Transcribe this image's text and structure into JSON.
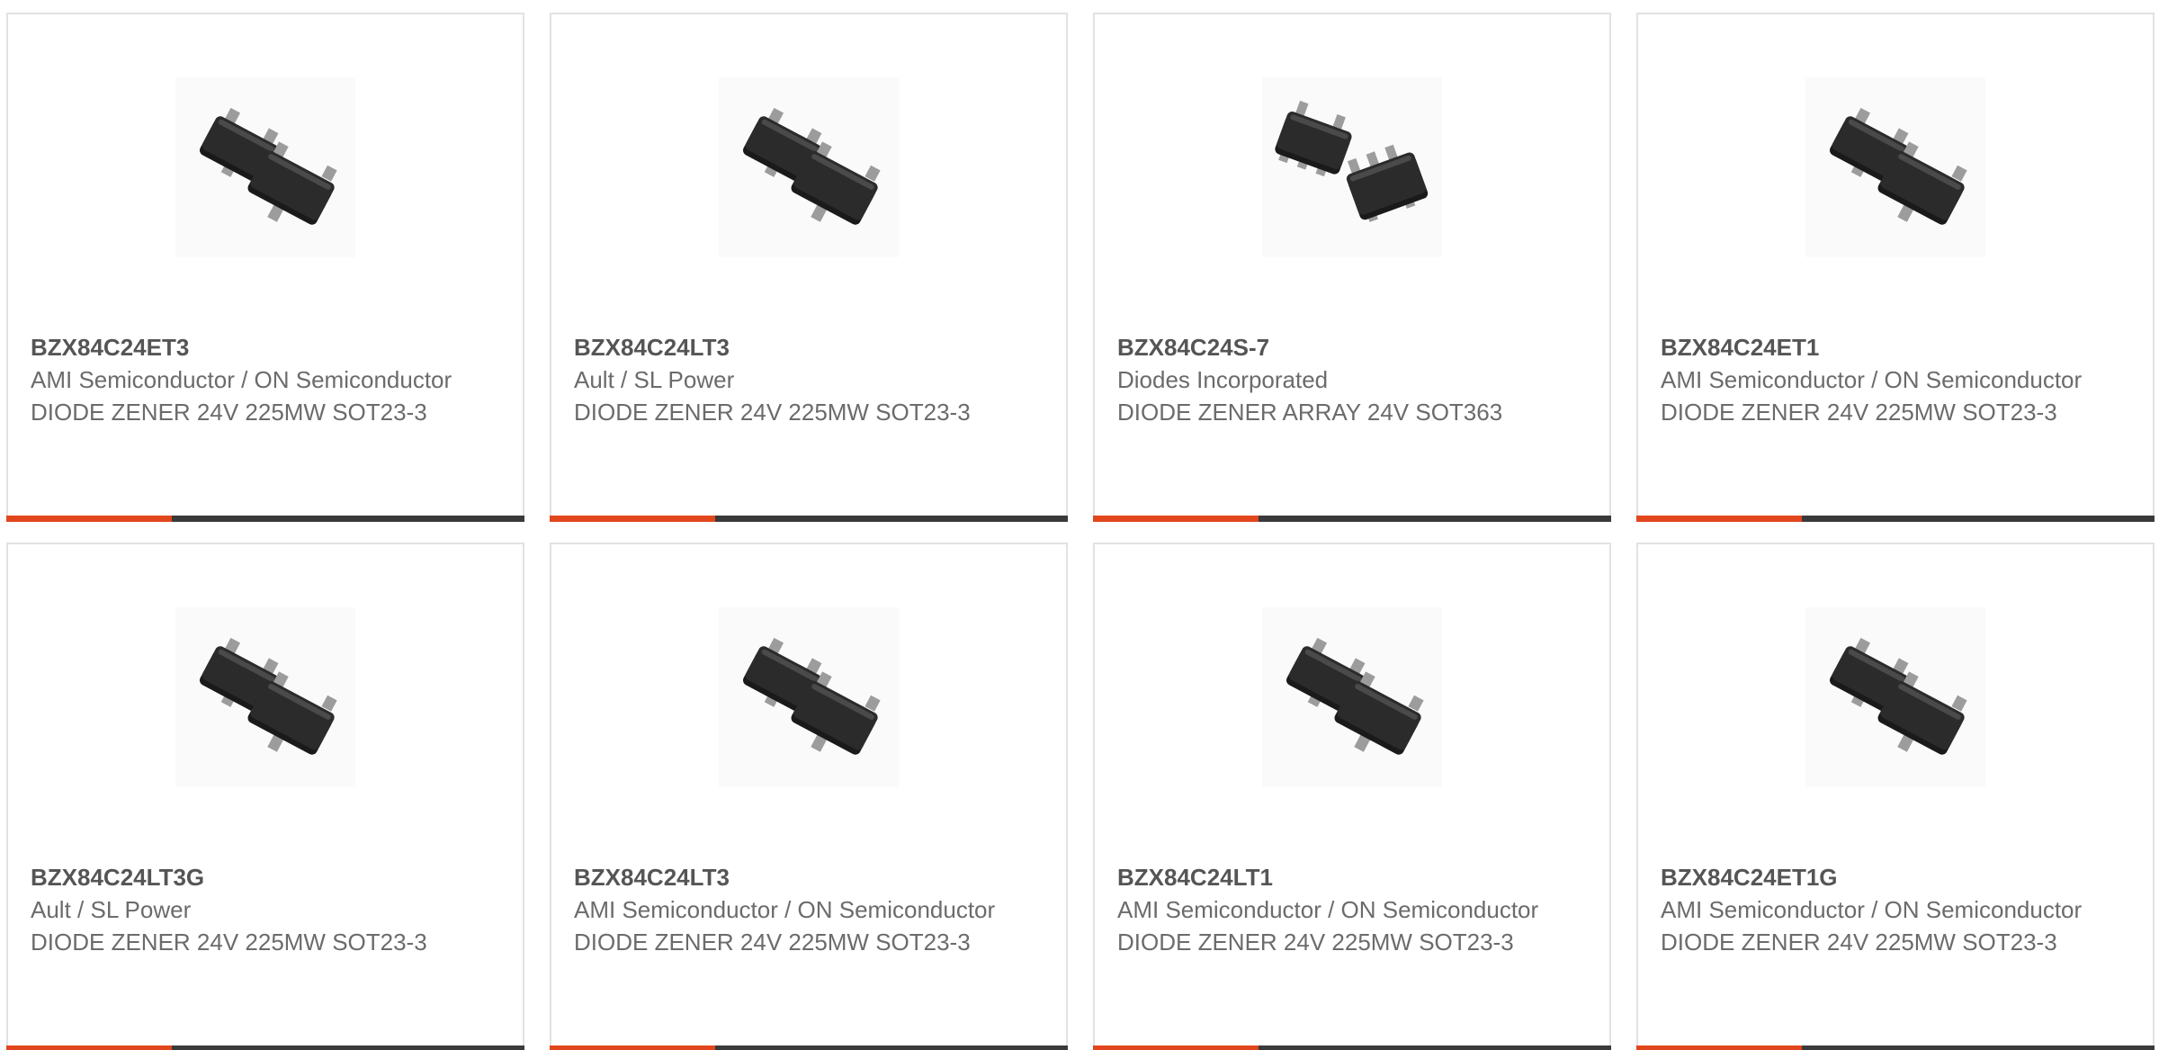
{
  "colors": {
    "accent": "#e2461c",
    "bar_dark": "#3a3a3a",
    "chip_body": "#2b2b2b",
    "chip_lead": "#9c9c9c"
  },
  "products": [
    {
      "part": "BZX84C24ET3",
      "manufacturer": "AMI Semiconductor / ON Semiconductor",
      "description": "DIODE ZENER 24V 225MW SOT23-3",
      "image_icon": "sot23-3-package-icon"
    },
    {
      "part": "BZX84C24LT3",
      "manufacturer": "Ault / SL Power",
      "description": "DIODE ZENER 24V 225MW SOT23-3",
      "image_icon": "sot23-3-package-icon"
    },
    {
      "part": "BZX84C24S-7",
      "manufacturer": "Diodes Incorporated",
      "description": "DIODE ZENER ARRAY 24V SOT363",
      "image_icon": "sot363-package-icon"
    },
    {
      "part": "BZX84C24ET1",
      "manufacturer": "AMI Semiconductor / ON Semiconductor",
      "description": "DIODE ZENER 24V 225MW SOT23-3",
      "image_icon": "sot23-3-package-icon"
    },
    {
      "part": "BZX84C24LT3G",
      "manufacturer": "Ault / SL Power",
      "description": "DIODE ZENER 24V 225MW SOT23-3",
      "image_icon": "sot23-3-package-icon"
    },
    {
      "part": "BZX84C24LT3",
      "manufacturer": "AMI Semiconductor / ON Semiconductor",
      "description": "DIODE ZENER 24V 225MW SOT23-3",
      "image_icon": "sot23-3-package-icon"
    },
    {
      "part": "BZX84C24LT1",
      "manufacturer": "AMI Semiconductor / ON Semiconductor",
      "description": "DIODE ZENER 24V 225MW SOT23-3",
      "image_icon": "sot23-3-package-icon"
    },
    {
      "part": "BZX84C24ET1G",
      "manufacturer": "AMI Semiconductor / ON Semiconductor",
      "description": "DIODE ZENER 24V 225MW SOT23-3",
      "image_icon": "sot23-3-package-icon"
    }
  ]
}
